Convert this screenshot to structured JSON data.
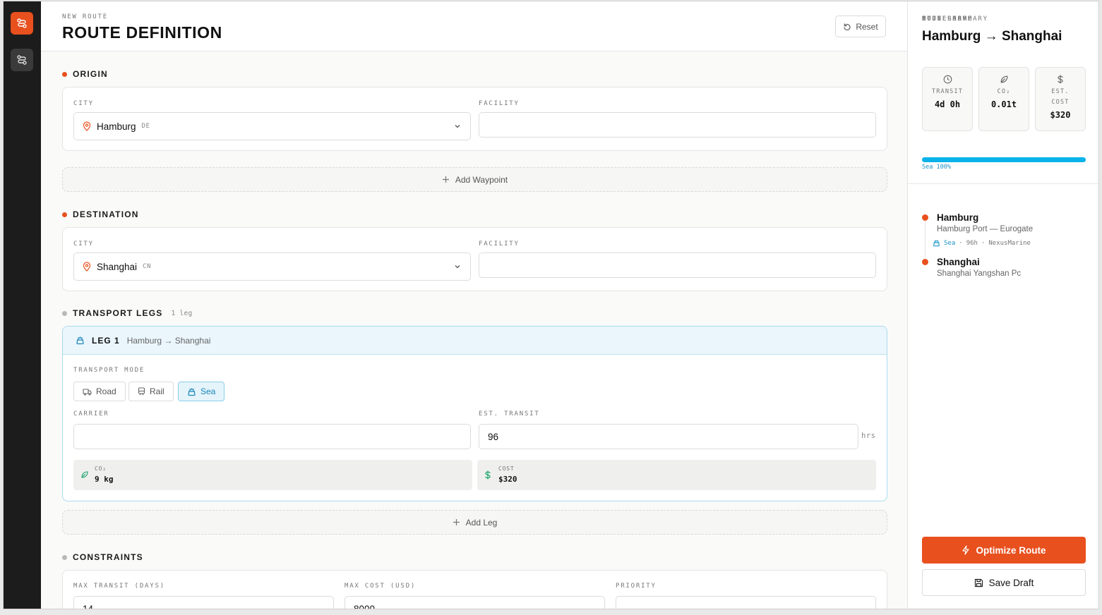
{
  "header": {
    "eyebrow": "NEW ROUTE",
    "title": "ROUTE DEFINITION",
    "reset_label": "Reset"
  },
  "origin": {
    "section_label": "ORIGIN",
    "city_label": "CITY",
    "city": "Hamburg",
    "country_code": "DE",
    "facility_label": "FACILITY",
    "facility_value": ""
  },
  "add_waypoint_label": "Add Waypoint",
  "destination": {
    "section_label": "DESTINATION",
    "city_label": "CITY",
    "city": "Shanghai",
    "country_code": "CN",
    "facility_label": "FACILITY",
    "facility_value": ""
  },
  "legs": {
    "section_label": "TRANSPORT LEGS",
    "count_label": "1 leg",
    "items": [
      {
        "title": "LEG 1",
        "route": "Hamburg → Shanghai",
        "mode_label": "TRANSPORT MODE",
        "modes": [
          "Road",
          "Rail",
          "Sea"
        ],
        "selected_mode": "Sea",
        "carrier_label": "CARRIER",
        "carrier_value": "",
        "transit_label": "EST. TRANSIT",
        "transit_value": "96",
        "transit_unit": "hrs",
        "co2_label": "CO₂",
        "co2_value": "9 kg",
        "cost_label": "COST",
        "cost_value": "$320"
      }
    ]
  },
  "add_leg_label": "Add Leg",
  "constraints": {
    "section_label": "CONSTRAINTS",
    "max_transit_label": "MAX TRANSIT (DAYS)",
    "max_transit_value": "14",
    "max_cost_label": "MAX COST (USD)",
    "max_cost_value": "8000",
    "priority_label": "PRIORITY",
    "priority_value": ""
  },
  "summary": {
    "eyebrow": "ROUTE SUMMARY",
    "title": "Hamburg → Shanghai",
    "transit_label": "TRANSIT",
    "transit_value": "4d 0h",
    "co2_label": "CO₂",
    "co2_value": "0.01t",
    "cost_label": "EST. COST",
    "cost_value": "$320",
    "mode_share_label": "MODE SHARE",
    "mode_share": [
      {
        "mode": "Sea",
        "percent": 100,
        "color": "#09b3ea"
      }
    ],
    "mode_share_legend": "Sea 100%"
  },
  "itinerary": {
    "label": "ITINERARY",
    "stops": [
      {
        "city": "Hamburg",
        "facility": "Hamburg Port — Eurogate"
      },
      {
        "city": "Shanghai",
        "facility": "Shanghai Yangshan Pc"
      }
    ],
    "leg_mode": "Sea",
    "leg_hours": "96h",
    "leg_carrier": "NexusMarine"
  },
  "actions": {
    "optimize_label": "Optimize Route",
    "save_label": "Save Draft"
  },
  "colors": {
    "accent": "#e8501e",
    "sea": "#09b3ea",
    "sidebar": "#1c1c1c"
  }
}
